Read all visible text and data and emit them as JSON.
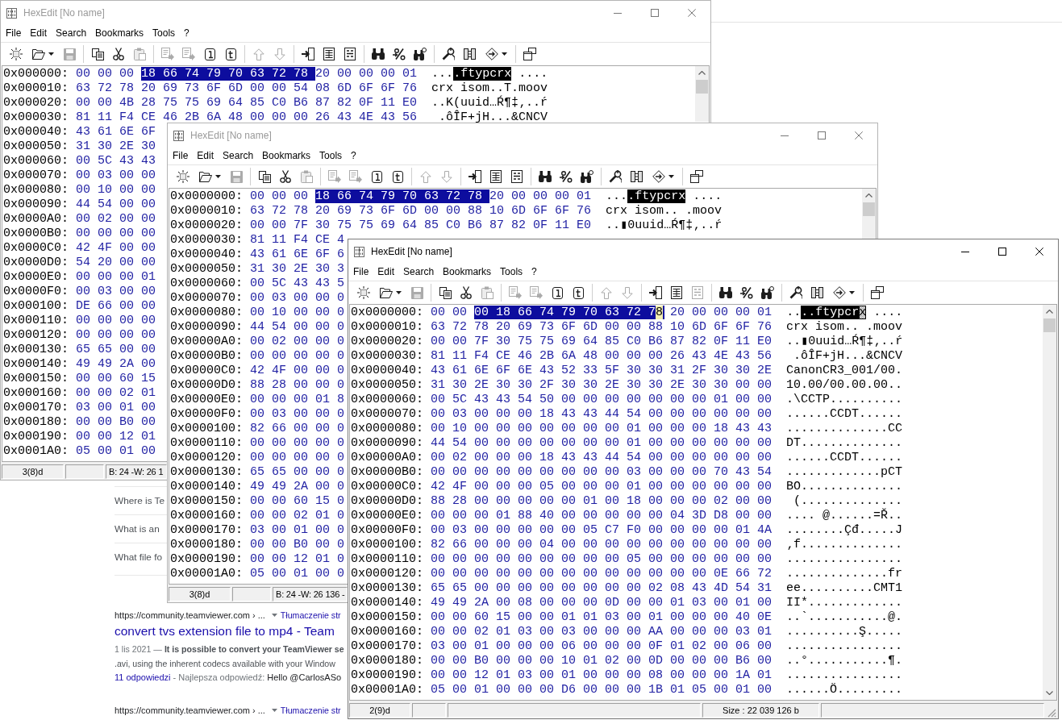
{
  "background_page": {
    "questions": [
      "Where is Te",
      "What is an",
      "What file fo"
    ],
    "results": [
      {
        "url": "https://community.teamviewer.com › ...",
        "translate": "Tłumaczenie str",
        "title": "convert tvs extension file to mp4 - Team",
        "date": "1 lis 2021 —",
        "snippet": [
          "It is possible to convert your TeamViewer se",
          ".avi, using the inherent codecs available with your Window"
        ],
        "answers": "11 odpowiedzi",
        "best_answer_label": "- Najlepsza odpowiedź:",
        "best_answer": "Hello @CarlosASo"
      },
      {
        "url": "https://community.teamviewer.com › ...",
        "translate": "Tłumaczenie str"
      }
    ]
  },
  "windows": [
    {
      "title": "HexEdit [No name]",
      "active": false,
      "menu": [
        "File",
        "Edit",
        "Search",
        "Bookmarks",
        "Tools",
        "?"
      ],
      "toolbar": [
        {
          "buttons": [
            {
              "disabled": false
            },
            {
              "disabled": false
            },
            {
              "disabled": true
            }
          ]
        },
        {
          "buttons": [
            {
              "disabled": false
            },
            {
              "disabled": false
            },
            {
              "disabled": true
            }
          ]
        },
        {
          "buttons": [
            {
              "disabled": true
            },
            {
              "disabled": true
            },
            {
              "disabled": false
            },
            {
              "disabled": false
            }
          ]
        },
        {
          "buttons": [
            {
              "disabled": true
            },
            {
              "disabled": true
            }
          ]
        },
        {
          "buttons": [
            {
              "disabled": false
            },
            {
              "disabled": false
            },
            {
              "disabled": false
            }
          ]
        },
        {
          "buttons": [
            {
              "disabled": false
            },
            {
              "disabled": false
            },
            {
              "disabled": false
            }
          ]
        },
        {
          "buttons": [
            {
              "disabled": false
            },
            {
              "disabled": false
            },
            {
              "disabled": false
            }
          ]
        },
        {
          "buttons": [
            {
              "disabled": false
            }
          ]
        }
      ],
      "rows": [
        {
          "address": "0x000000:",
          "hex": [
            {
              "text": "00 00 00 ",
              "selected": false,
              "caret": false
            },
            {
              "text": "18 66 74 79 70 63 72 78 ",
              "selected": true,
              "caret": false
            },
            {
              "text": "20 00 00 00 01",
              "selected": false,
              "caret": false
            }
          ],
          "ascii": [
            {
              "text": "...",
              "selected": false,
              "caret": false
            },
            {
              "text": ".ftypcrx",
              "selected": true,
              "caret": false
            },
            {
              "text": " ....",
              "selected": false,
              "caret": false
            }
          ]
        },
        {
          "address": "0x000010:",
          "hex": "63 72 78 20 69 73 6F 6D 00 00 54 08 6D 6F 6F 76",
          "ascii": "crx isom..T.moov"
        },
        {
          "address": "0x000020:",
          "hex": "00 00 4B 28 75 75 69 64 85 C0 B6 87 82 0F 11 E0",
          "ascii": "..K(uuid…Ŕ¶‡‚..ŕ"
        },
        {
          "address": "0x000030:",
          "hex": "81 11 F4 CE 46 2B 6A 48 00 00 00 26 43 4E 43 56",
          "ascii": " .ôÎF+jH...&CNCV"
        },
        {
          "address": "0x000040:",
          "hex": "43 61 6E 6F"
        },
        {
          "address": "0x000050:",
          "hex": "31 30 2E 30"
        },
        {
          "address": "0x000060:",
          "hex": "00 5C 43 43"
        },
        {
          "address": "0x000070:",
          "hex": "00 03 00 00"
        },
        {
          "address": "0x000080:",
          "hex": "00 10 00 00"
        },
        {
          "address": "0x000090:",
          "hex": "44 54 00 00"
        },
        {
          "address": "0x0000A0:",
          "hex": "00 02 00 00"
        },
        {
          "address": "0x0000B0:",
          "hex": "00 00 00 00"
        },
        {
          "address": "0x0000C0:",
          "hex": "42 4F 00 00"
        },
        {
          "address": "0x0000D0:",
          "hex": "54 20 00 00"
        },
        {
          "address": "0x0000E0:",
          "hex": "00 00 00 01"
        },
        {
          "address": "0x0000F0:",
          "hex": "00 03 00 00"
        },
        {
          "address": "0x000100:",
          "hex": "DE 66 00 00"
        },
        {
          "address": "0x000110:",
          "hex": "00 00 00 00"
        },
        {
          "address": "0x000120:",
          "hex": "00 00 00 00"
        },
        {
          "address": "0x000130:",
          "hex": "65 65 00 00"
        },
        {
          "address": "0x000140:",
          "hex": "49 49 2A 00"
        },
        {
          "address": "0x000150:",
          "hex": "00 00 60 15"
        },
        {
          "address": "0x000160:",
          "hex": "00 00 02 01"
        },
        {
          "address": "0x000170:",
          "hex": "03 00 01 00"
        },
        {
          "address": "0x000180:",
          "hex": "00 00 B0 00"
        },
        {
          "address": "0x000190:",
          "hex": "00 00 12 01"
        },
        {
          "address": "0x0001A0:",
          "hex": "05 00 01 00"
        }
      ],
      "status_bar": [
        "3(8)d",
        "B: 24 -W: 26 1"
      ]
    },
    {
      "title": "HexEdit [No name]",
      "active": false,
      "menu": [
        "File",
        "Edit",
        "Search",
        "Bookmarks",
        "Tools",
        "?"
      ],
      "toolbar": [
        {
          "buttons": [
            {
              "disabled": false
            },
            {
              "disabled": false
            },
            {
              "disabled": true
            }
          ]
        },
        {
          "buttons": [
            {
              "disabled": false
            },
            {
              "disabled": false
            },
            {
              "disabled": true
            }
          ]
        },
        {
          "buttons": [
            {
              "disabled": true
            },
            {
              "disabled": true
            },
            {
              "disabled": false
            },
            {
              "disabled": false
            }
          ]
        },
        {
          "buttons": [
            {
              "disabled": true
            },
            {
              "disabled": true
            }
          ]
        },
        {
          "buttons": [
            {
              "disabled": false
            },
            {
              "disabled": false
            },
            {
              "disabled": false
            }
          ]
        },
        {
          "buttons": [
            {
              "disabled": false
            },
            {
              "disabled": false
            },
            {
              "disabled": false
            }
          ]
        },
        {
          "buttons": [
            {
              "disabled": false
            },
            {
              "disabled": false
            },
            {
              "disabled": false
            }
          ]
        },
        {
          "buttons": [
            {
              "disabled": false
            }
          ]
        }
      ],
      "rows": [
        {
          "address": "0x0000000:",
          "hex": [
            {
              "text": "00 00 00 ",
              "selected": false,
              "caret": false
            },
            {
              "text": "18 66 74 79 70 63 72 78 ",
              "selected": true,
              "caret": false
            },
            {
              "text": "20 00 00 00 01",
              "selected": false,
              "caret": false
            }
          ],
          "ascii": [
            {
              "text": "...",
              "selected": false,
              "caret": false
            },
            {
              "text": ".ftypcrx",
              "selected": true,
              "caret": false
            },
            {
              "text": " ....",
              "selected": false,
              "caret": false
            }
          ]
        },
        {
          "address": "0x0000010:",
          "hex": "63 72 78 20 69 73 6F 6D 00 00 88 10 6D 6F 6F 76",
          "ascii": "crx isom.. .moov"
        },
        {
          "address": "0x0000020:",
          "hex": "00 00 7F 30 75 75 69 64 85 C0 B6 87 82 0F 11 E0",
          "ascii": "..▮0uuid…Ŕ¶‡‚..ŕ"
        },
        {
          "address": "0x0000030:",
          "hex": "81 11 F4 CE 4"
        },
        {
          "address": "0x0000040:",
          "hex": "43 61 6E 6F 6"
        },
        {
          "address": "0x0000050:",
          "hex": "31 30 2E 30 3"
        },
        {
          "address": "0x0000060:",
          "hex": "00 5C 43 43 5"
        },
        {
          "address": "0x0000070:",
          "hex": "00 03 00 00 0"
        },
        {
          "address": "0x0000080:",
          "hex": "00 10 00 00 0"
        },
        {
          "address": "0x0000090:",
          "hex": "44 54 00 00 0"
        },
        {
          "address": "0x00000A0:",
          "hex": "00 02 00 00 0"
        },
        {
          "address": "0x00000B0:",
          "hex": "00 00 00 00 0"
        },
        {
          "address": "0x00000C0:",
          "hex": "42 4F 00 00 0"
        },
        {
          "address": "0x00000D0:",
          "hex": "88 28 00 00 0"
        },
        {
          "address": "0x00000E0:",
          "hex": "00 00 00 01 8"
        },
        {
          "address": "0x00000F0:",
          "hex": "00 03 00 00 0"
        },
        {
          "address": "0x0000100:",
          "hex": "82 66 00 00 0"
        },
        {
          "address": "0x0000110:",
          "hex": "00 00 00 00 0"
        },
        {
          "address": "0x0000120:",
          "hex": "00 00 00 00 0"
        },
        {
          "address": "0x0000130:",
          "hex": "65 65 00 00 0"
        },
        {
          "address": "0x0000140:",
          "hex": "49 49 2A 00 0"
        },
        {
          "address": "0x0000150:",
          "hex": "00 00 60 15 0"
        },
        {
          "address": "0x0000160:",
          "hex": "00 00 02 01 0"
        },
        {
          "address": "0x0000170:",
          "hex": "03 00 01 00 0"
        },
        {
          "address": "0x0000180:",
          "hex": "00 00 B0 00 0"
        },
        {
          "address": "0x0000190:",
          "hex": "00 00 12 01 0"
        },
        {
          "address": "0x00001A0:",
          "hex": "05 00 01 00 0"
        }
      ],
      "status_bar": [
        "3(8)d",
        "B: 24 -W: 26 136 -"
      ]
    },
    {
      "title": "HexEdit [No name]",
      "active": true,
      "menu": [
        "File",
        "Edit",
        "Search",
        "Bookmarks",
        "Tools",
        "?"
      ],
      "toolbar": [
        {
          "buttons": [
            {
              "disabled": false
            },
            {
              "disabled": false
            },
            {
              "disabled": true
            }
          ]
        },
        {
          "buttons": [
            {
              "disabled": false
            },
            {
              "disabled": false
            },
            {
              "disabled": true
            }
          ]
        },
        {
          "buttons": [
            {
              "disabled": true
            },
            {
              "disabled": true
            },
            {
              "disabled": false
            },
            {
              "disabled": false
            }
          ]
        },
        {
          "buttons": [
            {
              "disabled": true
            },
            {
              "disabled": true
            }
          ]
        },
        {
          "buttons": [
            {
              "disabled": false
            },
            {
              "disabled": false
            },
            {
              "disabled": true
            }
          ]
        },
        {
          "buttons": [
            {
              "disabled": false
            },
            {
              "disabled": false
            },
            {
              "disabled": false
            }
          ]
        },
        {
          "buttons": [
            {
              "disabled": false
            },
            {
              "disabled": false
            },
            {
              "disabled": false
            }
          ]
        },
        {
          "buttons": [
            {
              "disabled": false
            }
          ]
        }
      ],
      "rows": [
        {
          "address": "0x0000000:",
          "hex": [
            {
              "text": "00 00 ",
              "selected": false,
              "caret": false
            },
            {
              "text": "00 18 66 74 79 70 63 72 7",
              "selected": true,
              "caret": false
            },
            {
              "text": "8",
              "selected": true,
              "caret": true
            },
            {
              "text": " 20 00 00 00 01",
              "selected": false,
              "caret": false
            }
          ],
          "ascii": [
            {
              "text": "..",
              "selected": false,
              "caret": false
            },
            {
              "text": "..ftypcr",
              "selected": true,
              "caret": false
            },
            {
              "text": "x",
              "selected": true,
              "caret": true
            },
            {
              "text": " ....",
              "selected": false,
              "caret": false
            }
          ]
        },
        {
          "address": "0x0000010:",
          "hex": "63 72 78 20 69 73 6F 6D 00 00 88 10 6D 6F 6F 76",
          "ascii": "crx isom.. .moov"
        },
        {
          "address": "0x0000020:",
          "hex": "00 00 7F 30 75 75 69 64 85 C0 B6 87 82 0F 11 E0",
          "ascii": "..▮0uuid…Ŕ¶‡‚..ŕ"
        },
        {
          "address": "0x0000030:",
          "hex": "81 11 F4 CE 46 2B 6A 48 00 00 00 26 43 4E 43 56",
          "ascii": " .ôÎF+jH...&CNCV"
        },
        {
          "address": "0x0000040:",
          "hex": "43 61 6E 6F 6E 43 52 33 5F 30 30 31 2F 30 30 2E",
          "ascii": "CanonCR3_001/00."
        },
        {
          "address": "0x0000050:",
          "hex": "31 30 2E 30 30 2F 30 30 2E 30 30 2E 30 30 00 00",
          "ascii": "10.00/00.00.00.."
        },
        {
          "address": "0x0000060:",
          "hex": "00 5C 43 43 54 50 00 00 00 00 00 00 00 01 00 00",
          "ascii": ".\\CCTP.........."
        },
        {
          "address": "0x0000070:",
          "hex": "00 03 00 00 00 18 43 43 44 54 00 00 00 00 00 00",
          "ascii": "......CCDT......"
        },
        {
          "address": "0x0000080:",
          "hex": "00 10 00 00 00 00 00 00 00 01 00 00 00 18 43 43",
          "ascii": "..............CC"
        },
        {
          "address": "0x0000090:",
          "hex": "44 54 00 00 00 00 00 00 00 01 00 00 00 00 00 00",
          "ascii": "DT.............."
        },
        {
          "address": "0x00000A0:",
          "hex": "00 02 00 00 00 18 43 43 44 54 00 00 00 00 00 00",
          "ascii": "......CCDT......"
        },
        {
          "address": "0x00000B0:",
          "hex": "00 00 00 00 00 00 00 00 00 03 00 00 00 70 43 54",
          "ascii": ".............pCT"
        },
        {
          "address": "0x00000C0:",
          "hex": "42 4F 00 00 00 05 00 00 00 01 00 00 00 00 00 00",
          "ascii": "BO.............."
        },
        {
          "address": "0x00000D0:",
          "hex": "88 28 00 00 00 00 00 01 00 18 00 00 00 02 00 00",
          "ascii": " (.............."
        },
        {
          "address": "0x00000E0:",
          "hex": "00 00 00 01 88 40 00 00 00 00 00 04 3D D8 00 00",
          "ascii": ".... @......=Ř.."
        },
        {
          "address": "0x00000F0:",
          "hex": "00 03 00 00 00 00 00 05 C7 F0 00 00 00 00 01 4A",
          "ascii": "........Çđ.....J"
        },
        {
          "address": "0x0000100:",
          "hex": "82 66 00 00 00 04 00 00 00 00 00 00 00 00 00 00",
          "ascii": "‚f.............."
        },
        {
          "address": "0x0000110:",
          "hex": "00 00 00 00 00 00 00 00 00 05 00 00 00 00 00 00",
          "ascii": "................"
        },
        {
          "address": "0x0000120:",
          "hex": "00 00 00 00 00 00 00 00 00 00 00 00 00 0E 66 72",
          "ascii": "..............fr"
        },
        {
          "address": "0x0000130:",
          "hex": "65 65 00 00 00 00 00 00 00 00 02 08 43 4D 54 31",
          "ascii": "ee..........CMT1"
        },
        {
          "address": "0x0000140:",
          "hex": "49 49 2A 00 08 00 00 00 0D 00 00 01 03 00 01 00",
          "ascii": "II*............."
        },
        {
          "address": "0x0000150:",
          "hex": "00 00 60 15 00 00 01 01 03 00 01 00 00 00 40 0E",
          "ascii": "..`...........@."
        },
        {
          "address": "0x0000160:",
          "hex": "00 00 02 01 03 00 03 00 00 00 AA 00 00 00 03 01",
          "ascii": "..........Ş....."
        },
        {
          "address": "0x0000170:",
          "hex": "03 00 01 00 00 00 06 00 00 00 0F 01 02 00 06 00",
          "ascii": "................"
        },
        {
          "address": "0x0000180:",
          "hex": "00 00 B0 00 00 00 10 01 02 00 0D 00 00 00 B6 00",
          "ascii": "..°...........¶."
        },
        {
          "address": "0x0000190:",
          "hex": "00 00 12 01 03 00 01 00 00 00 08 00 00 00 1A 01",
          "ascii": "................"
        },
        {
          "address": "0x00001A0:",
          "hex": "05 00 01 00 00 00 D6 00 00 00 1B 01 05 00 01 00",
          "ascii": "......Ö........."
        }
      ],
      "status_bar": [
        "2(9)d",
        "Size : 22 039 126 b"
      ]
    }
  ]
}
